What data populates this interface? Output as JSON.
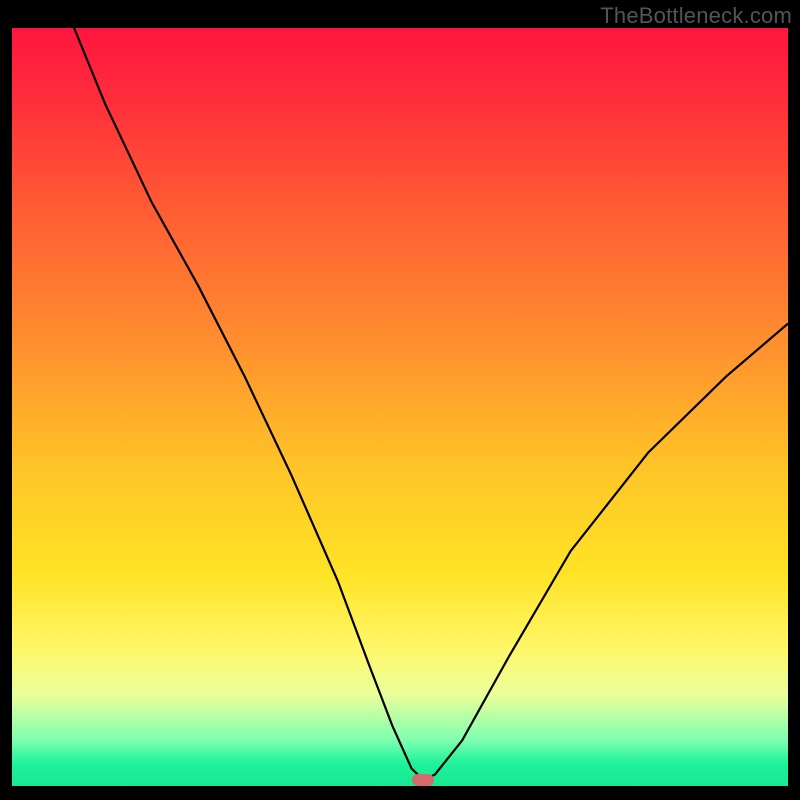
{
  "attribution": "TheBottleneck.com",
  "chart_data": {
    "type": "line",
    "title": "",
    "xlabel": "",
    "ylabel": "",
    "xlim": [
      0,
      100
    ],
    "ylim": [
      0,
      100
    ],
    "grid": false,
    "series": [
      {
        "name": "curve",
        "x": [
          8,
          12,
          18,
          24,
          30,
          36,
          42,
          46,
          49,
          51.5,
          53,
          54.5,
          58,
          64,
          72,
          82,
          92,
          100
        ],
        "y": [
          100,
          90,
          77,
          66,
          54,
          41,
          27,
          16,
          8,
          2.3,
          0.8,
          1.5,
          6,
          17,
          31,
          44,
          54,
          61
        ]
      }
    ],
    "marker": {
      "x": 53,
      "y": 0.8,
      "color": "#d46a6a"
    },
    "background_gradient": [
      "#ff1540",
      "#ffe325",
      "#18e892"
    ]
  }
}
